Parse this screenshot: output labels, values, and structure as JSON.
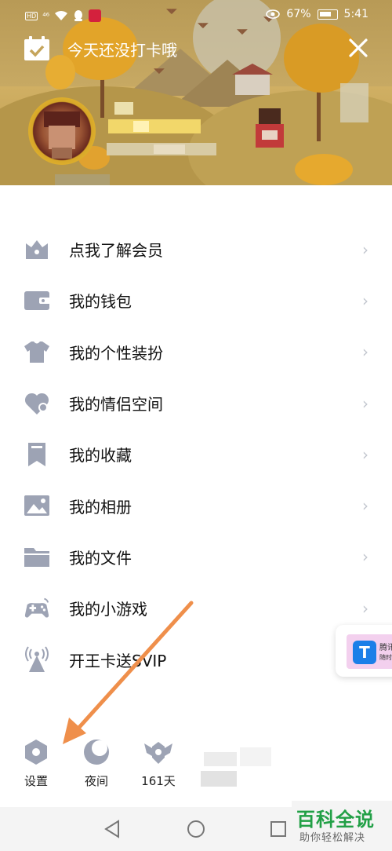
{
  "status_bar": {
    "hd": "HD",
    "signal": "⁴⁶",
    "battery_pct": "67%",
    "time": "5:41"
  },
  "header": {
    "checkin_text": "今天还没打卡哦"
  },
  "menu": {
    "items": [
      {
        "label": "点我了解会员",
        "icon": "crown-icon"
      },
      {
        "label": "我的钱包",
        "icon": "wallet-icon"
      },
      {
        "label": "我的个性装扮",
        "icon": "shirt-icon"
      },
      {
        "label": "我的情侣空间",
        "icon": "heart-icon"
      },
      {
        "label": "我的收藏",
        "icon": "bookmark-icon"
      },
      {
        "label": "我的相册",
        "icon": "image-icon"
      },
      {
        "label": "我的文件",
        "icon": "folder-icon"
      },
      {
        "label": "我的小游戏",
        "icon": "gamepad-icon"
      },
      {
        "label": "开王卡送SVIP",
        "icon": "antenna-icon"
      }
    ]
  },
  "floating_card": {
    "line1": "腾讯",
    "line2": "随时"
  },
  "bottom_bar": {
    "settings": "设置",
    "night": "夜间",
    "days": "161天"
  },
  "watermark": {
    "title": "百科全说",
    "subtitle": "助你轻松解决"
  },
  "colors": {
    "icon_gray": "#9da3b4",
    "annotation_arrow": "#ef8f4b",
    "watermark_green": "#22a046"
  }
}
